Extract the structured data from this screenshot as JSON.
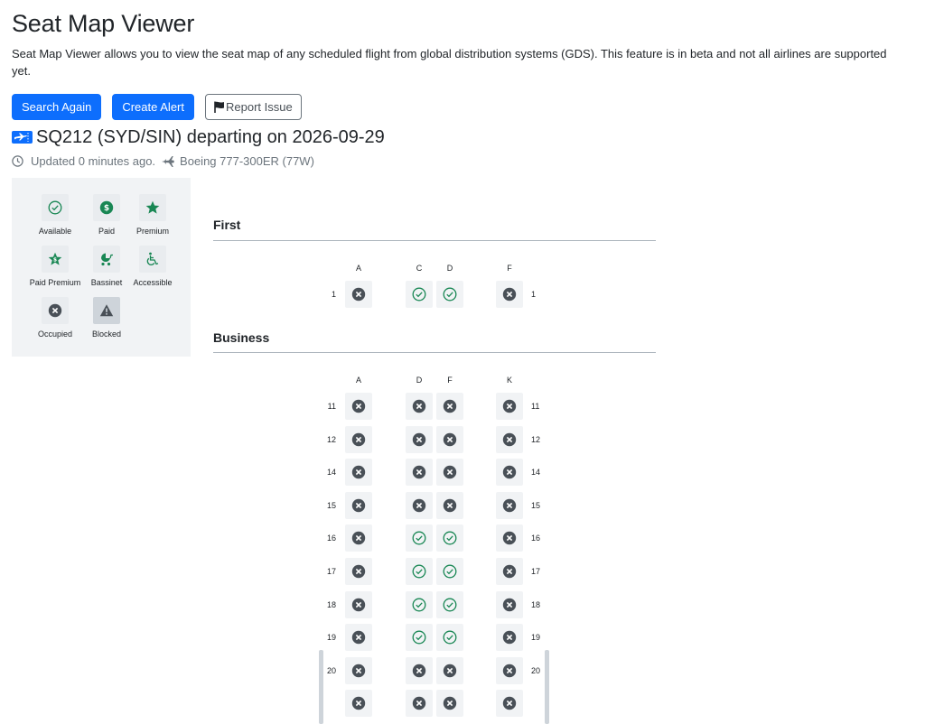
{
  "page": {
    "title": "Seat Map Viewer",
    "description": "Seat Map Viewer allows you to view the seat map of any scheduled flight from global distribution systems (GDS). This feature is in beta and not all airlines are supported yet."
  },
  "actions": {
    "search_again": "Search Again",
    "create_alert": "Create Alert",
    "report_issue": "Report Issue"
  },
  "flight": {
    "heading": "SQ212 (SYD/SIN) departing on 2026-09-29",
    "updated": "Updated 0 minutes ago.",
    "aircraft": "Boeing 777-300ER (77W)"
  },
  "legend": {
    "available": "Available",
    "paid": "Paid",
    "premium": "Premium",
    "paid_premium": "Paid Premium",
    "bassinet": "Bassinet",
    "accessible": "Accessible",
    "occupied": "Occupied",
    "blocked": "Blocked"
  },
  "colors": {
    "primary": "#0d6efd",
    "available": "#198754",
    "occupied": "#495057",
    "panel": "#f1f3f5"
  },
  "cabins": [
    {
      "name": "First",
      "columns": [
        "A",
        "C",
        "D",
        "F"
      ],
      "rows": [
        {
          "number": "1",
          "seats": [
            "occupied",
            "available",
            "available",
            "occupied"
          ]
        }
      ]
    },
    {
      "name": "Business",
      "columns": [
        "A",
        "D",
        "F",
        "K"
      ],
      "rows": [
        {
          "number": "11",
          "seats": [
            "occupied",
            "occupied",
            "occupied",
            "occupied"
          ]
        },
        {
          "number": "12",
          "seats": [
            "occupied",
            "occupied",
            "occupied",
            "occupied"
          ]
        },
        {
          "number": "14",
          "seats": [
            "occupied",
            "occupied",
            "occupied",
            "occupied"
          ]
        },
        {
          "number": "15",
          "seats": [
            "occupied",
            "occupied",
            "occupied",
            "occupied"
          ]
        },
        {
          "number": "16",
          "seats": [
            "occupied",
            "available",
            "available",
            "occupied"
          ]
        },
        {
          "number": "17",
          "seats": [
            "occupied",
            "available",
            "available",
            "occupied"
          ]
        },
        {
          "number": "18",
          "seats": [
            "occupied",
            "available",
            "available",
            "occupied"
          ]
        },
        {
          "number": "19",
          "seats": [
            "occupied",
            "available",
            "available",
            "occupied"
          ]
        },
        {
          "number": "20",
          "seats": [
            "occupied",
            "occupied",
            "occupied",
            "occupied"
          ]
        },
        {
          "number": "",
          "seats": [
            "occupied",
            "occupied",
            "occupied",
            "occupied"
          ]
        }
      ]
    }
  ]
}
